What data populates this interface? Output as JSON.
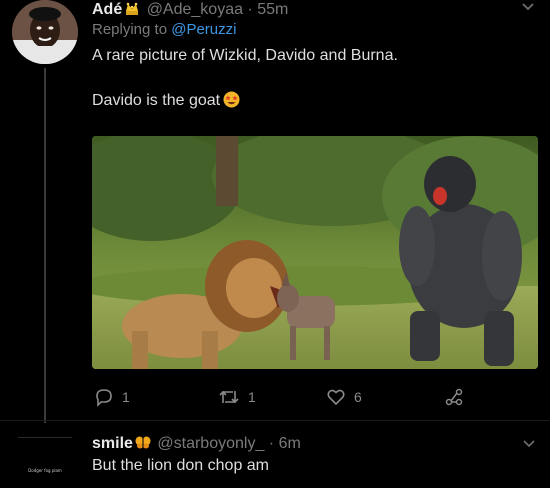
{
  "tweet": {
    "author_name": "Adé",
    "author_handle": "@Ade_koyaa",
    "separator": "·",
    "time": "55m",
    "replying_prefix": "Replying to",
    "replying_mention": "@Peruzzi",
    "text_line1": "A rare picture of Wizkid, Davido and Burna.",
    "text_line2": "Davido is the goat",
    "badge_icon": "crown-emoji",
    "text_emoji": "star-struck-emoji",
    "photo_subject": "lion-donkey-gorilla-photo",
    "actions": {
      "reply_count": "1",
      "retweet_count": "1",
      "like_count": "6"
    }
  },
  "reply": {
    "author_name": "smile",
    "author_handle": "@starboyonly_",
    "separator": "·",
    "time": "6m",
    "name_emoji": "butterfly-emoji",
    "text": "But the lion don chop am",
    "avatar_caption": "Dodger fog plam"
  },
  "colors": {
    "background": "#000000",
    "link": "#3d97e3",
    "muted": "#7a7a7a",
    "text": "#dedede"
  }
}
